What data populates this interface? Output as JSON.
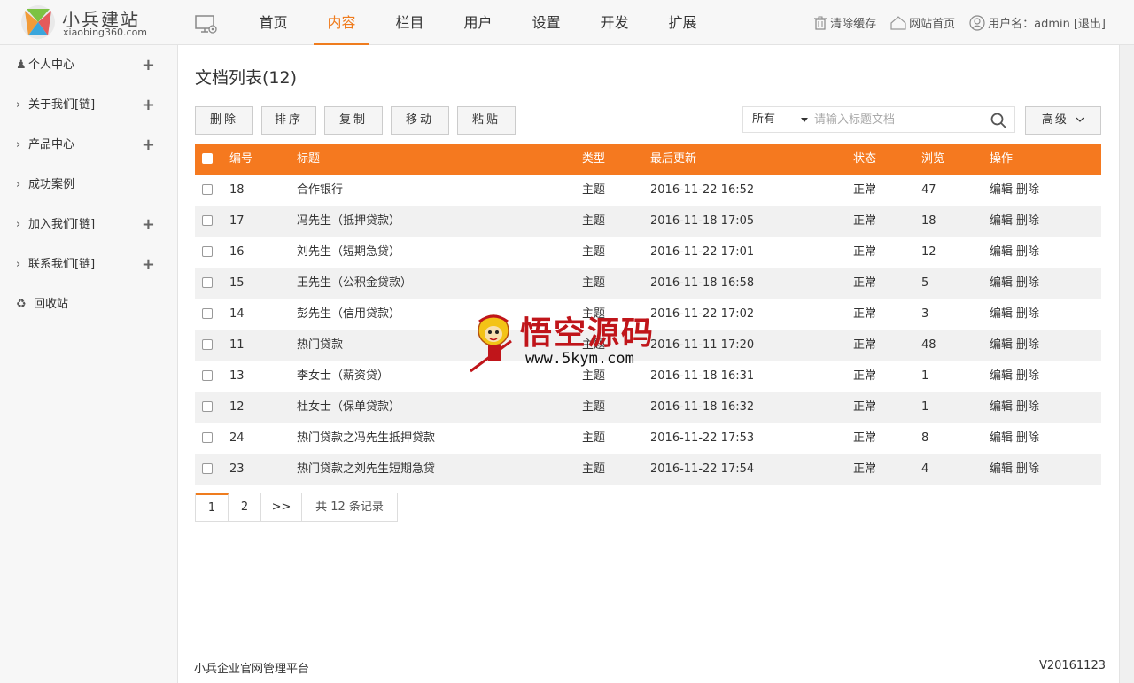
{
  "header": {
    "logo_title": "小兵建站",
    "logo_sub": "xiaobing360.com",
    "nav": [
      {
        "label": "首页",
        "active": false
      },
      {
        "label": "内容",
        "active": true
      },
      {
        "label": "栏目",
        "active": false
      },
      {
        "label": "用户",
        "active": false
      },
      {
        "label": "设置",
        "active": false
      },
      {
        "label": "开发",
        "active": false
      },
      {
        "label": "扩展",
        "active": false
      }
    ],
    "clear_cache": "清除缓存",
    "site_home": "网站首页",
    "user_label": "用户名：admin",
    "logout": "[退出]"
  },
  "sidebar": {
    "items": [
      {
        "label": "个人中心",
        "icon": "user-icon",
        "expandable": true
      },
      {
        "label": "关于我们[链]",
        "icon": "chevron-right-icon",
        "expandable": true
      },
      {
        "label": "产品中心",
        "icon": "chevron-right-icon",
        "expandable": true
      },
      {
        "label": "成功案例",
        "icon": "chevron-right-icon",
        "expandable": false
      },
      {
        "label": "加入我们[链]",
        "icon": "chevron-right-icon",
        "expandable": true
      },
      {
        "label": "联系我们[链]",
        "icon": "chevron-right-icon",
        "expandable": true
      },
      {
        "label": "回收站",
        "icon": "recycle-icon",
        "expandable": false
      }
    ]
  },
  "main": {
    "title": "文档列表(12)",
    "buttons": {
      "delete": "删除",
      "sort": "排序",
      "copy": "复制",
      "move": "移动",
      "paste": "粘贴"
    },
    "search": {
      "scope": "所有",
      "placeholder": "请输入标题文档"
    },
    "advanced": "高级",
    "columns": {
      "id": "编号",
      "title": "标题",
      "type": "类型",
      "updated": "最后更新",
      "status": "状态",
      "views": "浏览",
      "actions": "操作"
    },
    "rows": [
      {
        "id": "18",
        "title": "合作银行",
        "type": "主题",
        "updated": "2016-11-22 16:52",
        "status": "正常",
        "views": "47",
        "edit": "编辑",
        "delete": "删除"
      },
      {
        "id": "17",
        "title": "冯先生（抵押贷款）",
        "type": "主题",
        "updated": "2016-11-18 17:05",
        "status": "正常",
        "views": "18",
        "edit": "编辑",
        "delete": "删除"
      },
      {
        "id": "16",
        "title": "刘先生（短期急贷）",
        "type": "主题",
        "updated": "2016-11-22 17:01",
        "status": "正常",
        "views": "12",
        "edit": "编辑",
        "delete": "删除"
      },
      {
        "id": "15",
        "title": "王先生（公积金贷款）",
        "type": "主题",
        "updated": "2016-11-18 16:58",
        "status": "正常",
        "views": "5",
        "edit": "编辑",
        "delete": "删除"
      },
      {
        "id": "14",
        "title": "彭先生（信用贷款）",
        "type": "主题",
        "updated": "2016-11-22 17:02",
        "status": "正常",
        "views": "3",
        "edit": "编辑",
        "delete": "删除"
      },
      {
        "id": "11",
        "title": "热门贷款",
        "type": "主题",
        "updated": "2016-11-11 17:20",
        "status": "正常",
        "views": "48",
        "edit": "编辑",
        "delete": "删除"
      },
      {
        "id": "13",
        "title": "李女士（薪资贷）",
        "type": "主题",
        "updated": "2016-11-18 16:31",
        "status": "正常",
        "views": "1",
        "edit": "编辑",
        "delete": "删除"
      },
      {
        "id": "12",
        "title": "杜女士（保单贷款）",
        "type": "主题",
        "updated": "2016-11-18 16:32",
        "status": "正常",
        "views": "1",
        "edit": "编辑",
        "delete": "删除"
      },
      {
        "id": "24",
        "title": "热门贷款之冯先生抵押贷款",
        "type": "主题",
        "updated": "2016-11-22 17:53",
        "status": "正常",
        "views": "8",
        "edit": "编辑",
        "delete": "删除"
      },
      {
        "id": "23",
        "title": "热门贷款之刘先生短期急贷",
        "type": "主题",
        "updated": "2016-11-22 17:54",
        "status": "正常",
        "views": "4",
        "edit": "编辑",
        "delete": "删除"
      }
    ],
    "pager": {
      "pages": [
        "1",
        "2"
      ],
      "next": ">>",
      "total": "共 12 条记录"
    }
  },
  "watermark": {
    "title": "悟空源码",
    "url": "www.5kym.com"
  },
  "footer": {
    "left": "小兵企业官网管理平台",
    "right": "V20161123"
  },
  "colors": {
    "accent": "#ef7c1e",
    "table_header": "#f5791f"
  }
}
